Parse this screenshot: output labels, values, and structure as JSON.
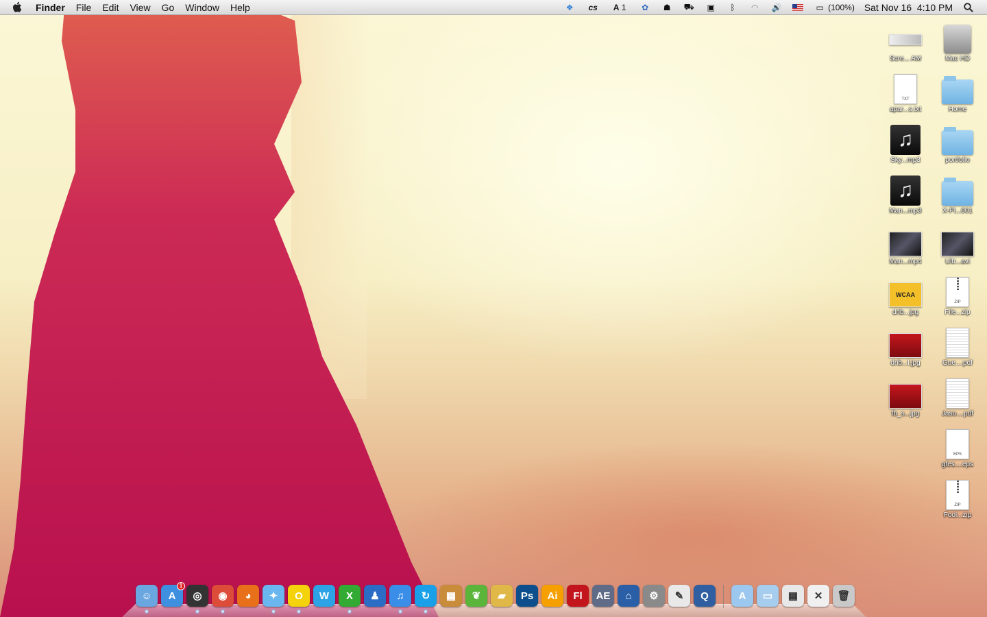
{
  "menubar": {
    "app_name": "Finder",
    "menus": [
      "File",
      "Edit",
      "View",
      "Go",
      "Window",
      "Help"
    ],
    "status": {
      "text_1": "1",
      "battery": "(100%)",
      "datetime": "Sat Nov 16  4:10 PM"
    }
  },
  "desktop_icons": [
    {
      "label": "Scre... AM",
      "kind": "screenshot"
    },
    {
      "label": "Mac HD",
      "kind": "harddisk"
    },
    {
      "label": "apar...s.txt",
      "kind": "txt",
      "tag": "TXT"
    },
    {
      "label": "Home",
      "kind": "folder"
    },
    {
      "label": "Sky...mp3",
      "kind": "music"
    },
    {
      "label": "portfolio",
      "kind": "folder"
    },
    {
      "label": "Man...mp3",
      "kind": "music"
    },
    {
      "label": "X-Pl...001",
      "kind": "folder"
    },
    {
      "label": "Man...mp4",
      "kind": "video"
    },
    {
      "label": "Ultr...avi",
      "kind": "video"
    },
    {
      "label": "drib...jpg",
      "kind": "image",
      "caption": "WCAA"
    },
    {
      "label": "File...zip",
      "kind": "zip",
      "tag": "ZIP"
    },
    {
      "label": "drib...l.jpg",
      "kind": "image"
    },
    {
      "label": "Gue....pdf",
      "kind": "pdf"
    },
    {
      "label": "fb_s...jpg",
      "kind": "image"
    },
    {
      "label": "Jaso....pdf",
      "kind": "pdf"
    },
    {
      "label": "gfes....eps",
      "kind": "eps",
      "tag": "EPS"
    },
    {
      "label": "Fool...zip",
      "kind": "zip",
      "tag": "ZIP"
    }
  ],
  "dock": {
    "app_store_badge": "1",
    "apps": [
      {
        "name": "finder-icon",
        "bg": "#6aa6e0",
        "glyph": "☺"
      },
      {
        "name": "app-store-icon",
        "bg": "#3f8fe0",
        "glyph": "A"
      },
      {
        "name": "dashboard-icon",
        "bg": "#333333",
        "glyph": "◎"
      },
      {
        "name": "chrome-icon",
        "bg": "#dd4b39",
        "glyph": "◉"
      },
      {
        "name": "firefox-icon",
        "bg": "#e8701a",
        "glyph": "◕"
      },
      {
        "name": "safari-icon",
        "bg": "#6ab7f0",
        "glyph": "✦"
      },
      {
        "name": "opera-icon",
        "bg": "#f4d20c",
        "glyph": "O"
      },
      {
        "name": "word-icon",
        "bg": "#2da3e6",
        "glyph": "W"
      },
      {
        "name": "excel-icon",
        "bg": "#33aa33",
        "glyph": "X"
      },
      {
        "name": "cyberduck-icon",
        "bg": "#2b6cc4",
        "glyph": "♟"
      },
      {
        "name": "itunes-icon",
        "bg": "#3a8ee8",
        "glyph": "♫"
      },
      {
        "name": "rdio-icon",
        "bg": "#1aa0e8",
        "glyph": "↻"
      },
      {
        "name": "archive-icon",
        "bg": "#c98c3a",
        "glyph": "▦"
      },
      {
        "name": "evernote-icon",
        "bg": "#5bb53a",
        "glyph": "❦"
      },
      {
        "name": "transmit-icon",
        "bg": "#e0b848",
        "glyph": "▰"
      },
      {
        "name": "photoshop-icon",
        "bg": "#0c4f8c",
        "glyph": "Ps"
      },
      {
        "name": "illustrator-icon",
        "bg": "#f5a000",
        "glyph": "Ai"
      },
      {
        "name": "flash-icon",
        "bg": "#c3161c",
        "glyph": "Fl"
      },
      {
        "name": "aftereffects-icon",
        "bg": "#5f6b87",
        "glyph": "AE"
      },
      {
        "name": "home-app-icon",
        "bg": "#2a5fa8",
        "glyph": "⌂"
      },
      {
        "name": "system-preferences-icon",
        "bg": "#8a8a8a",
        "glyph": "⚙"
      },
      {
        "name": "textedit-icon",
        "bg": "#e9e9e9",
        "glyph": "✎"
      },
      {
        "name": "quicktime-icon",
        "bg": "#2f5fa0",
        "glyph": "Q"
      }
    ],
    "stacks": [
      {
        "name": "applications-stack-icon",
        "bg": "#9cc7ee",
        "glyph": "A"
      },
      {
        "name": "documents-stack-icon",
        "bg": "#a7cdee",
        "glyph": "▭"
      },
      {
        "name": "calculator-stack-icon",
        "bg": "#e8e8e8",
        "glyph": "▦"
      },
      {
        "name": "excel-doc-stack-icon",
        "bg": "#f0f0f0",
        "glyph": "✕"
      },
      {
        "name": "trash-icon",
        "bg": "#c9c9c9",
        "glyph": "🗑"
      }
    ]
  }
}
